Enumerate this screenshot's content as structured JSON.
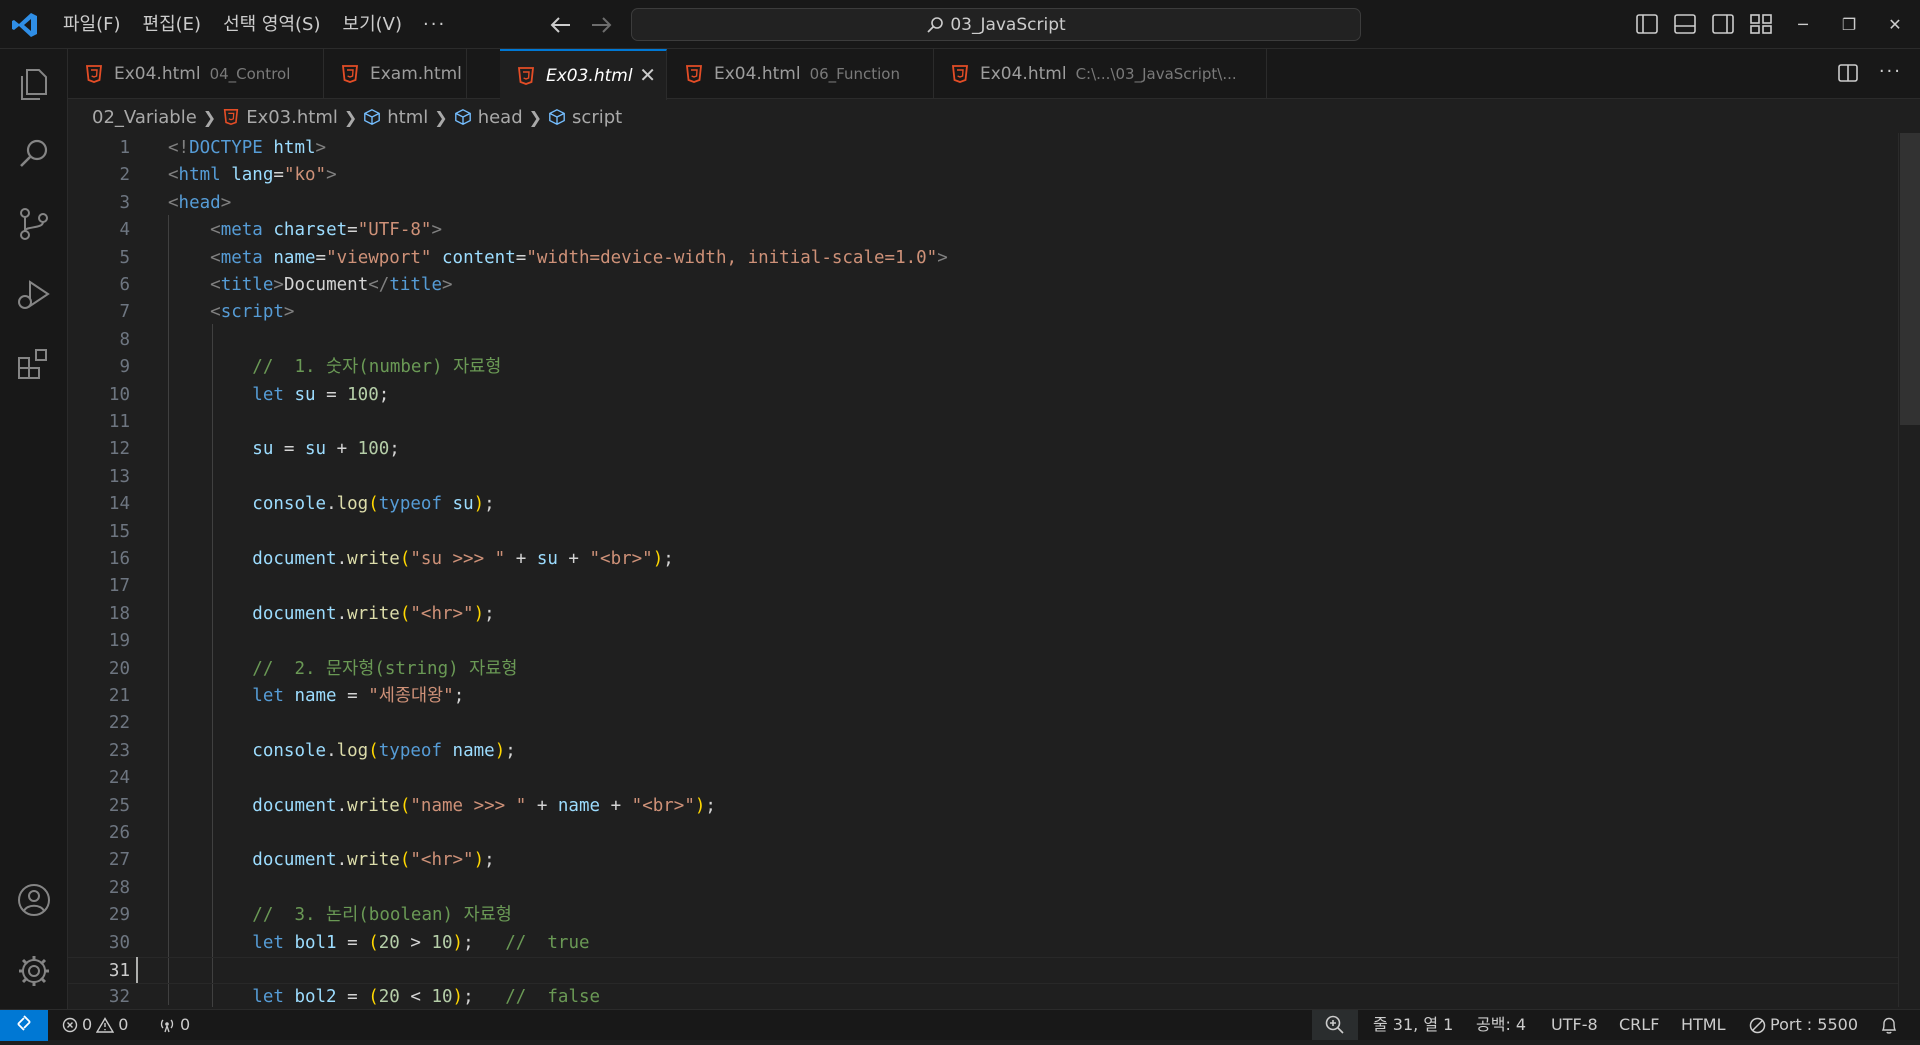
{
  "menu": {
    "items": [
      "파일(F)",
      "편집(E)",
      "선택 영역(S)",
      "보기(V)"
    ],
    "more": "···"
  },
  "command_center": {
    "text": "03_JavaScript"
  },
  "tabs": [
    {
      "name": "Ex04.html",
      "desc": "04_Control",
      "active": false
    },
    {
      "name": "Exam.html",
      "desc": "",
      "active": false
    },
    {
      "name": "Ex03.html",
      "desc": "",
      "active": true
    },
    {
      "name": "Ex04.html",
      "desc": "06_Function",
      "active": false
    },
    {
      "name": "Ex04.html",
      "desc": "C:\\...\\03_JavaScript\\...",
      "active": false
    }
  ],
  "tab_close_glyph": "✕",
  "tab_actions_more": "···",
  "breadcrumb": {
    "folder": "02_Variable",
    "file": "Ex03.html",
    "items": [
      "html",
      "head",
      "script"
    ]
  },
  "current_line": 31,
  "code_lines": [
    [
      [
        "t-br",
        "<!"
      ],
      [
        "t-tag",
        "DOCTYPE "
      ],
      [
        "t-attr",
        "html"
      ],
      [
        "t-br",
        ">"
      ]
    ],
    [
      [
        "t-br",
        "<"
      ],
      [
        "t-tag",
        "html "
      ],
      [
        "t-attr",
        "lang"
      ],
      [
        "t-txt",
        "="
      ],
      [
        "t-str",
        "\"ko\""
      ],
      [
        "t-br",
        ">"
      ]
    ],
    [
      [
        "t-br",
        "<"
      ],
      [
        "t-tag",
        "head"
      ],
      [
        "t-br",
        ">"
      ]
    ],
    [
      [
        "t-txt",
        "    "
      ],
      [
        "t-br",
        "<"
      ],
      [
        "t-tag",
        "meta "
      ],
      [
        "t-attr",
        "charset"
      ],
      [
        "t-txt",
        "="
      ],
      [
        "t-str",
        "\"UTF-8\""
      ],
      [
        "t-br",
        ">"
      ]
    ],
    [
      [
        "t-txt",
        "    "
      ],
      [
        "t-br",
        "<"
      ],
      [
        "t-tag",
        "meta "
      ],
      [
        "t-attr",
        "name"
      ],
      [
        "t-txt",
        "="
      ],
      [
        "t-str",
        "\"viewport\" "
      ],
      [
        "t-attr",
        "content"
      ],
      [
        "t-txt",
        "="
      ],
      [
        "t-str",
        "\"width=device-width, initial-scale=1.0\""
      ],
      [
        "t-br",
        ">"
      ]
    ],
    [
      [
        "t-txt",
        "    "
      ],
      [
        "t-br",
        "<"
      ],
      [
        "t-tag",
        "title"
      ],
      [
        "t-br",
        ">"
      ],
      [
        "t-txt",
        "Document"
      ],
      [
        "t-br",
        "</"
      ],
      [
        "t-tag",
        "title"
      ],
      [
        "t-br",
        ">"
      ]
    ],
    [
      [
        "t-txt",
        "    "
      ],
      [
        "t-br",
        "<"
      ],
      [
        "t-tag",
        "script"
      ],
      [
        "t-br",
        ">"
      ]
    ],
    [],
    [
      [
        "t-txt",
        "        "
      ],
      [
        "t-com",
        "//  1. 숫자(number) 자료형"
      ]
    ],
    [
      [
        "t-txt",
        "        "
      ],
      [
        "t-kw",
        "let "
      ],
      [
        "t-var",
        "su"
      ],
      [
        "t-txt",
        " = "
      ],
      [
        "t-num",
        "100"
      ],
      [
        "t-txt",
        ";"
      ]
    ],
    [],
    [
      [
        "t-txt",
        "        "
      ],
      [
        "t-var",
        "su"
      ],
      [
        "t-txt",
        " = "
      ],
      [
        "t-var",
        "su"
      ],
      [
        "t-txt",
        " + "
      ],
      [
        "t-num",
        "100"
      ],
      [
        "t-txt",
        ";"
      ]
    ],
    [],
    [
      [
        "t-txt",
        "        "
      ],
      [
        "t-var",
        "console"
      ],
      [
        "t-txt",
        "."
      ],
      [
        "t-fn",
        "log"
      ],
      [
        "t-paren",
        "("
      ],
      [
        "t-kw",
        "typeof "
      ],
      [
        "t-var",
        "su"
      ],
      [
        "t-paren",
        ")"
      ],
      [
        "t-txt",
        ";"
      ]
    ],
    [],
    [
      [
        "t-txt",
        "        "
      ],
      [
        "t-var",
        "document"
      ],
      [
        "t-txt",
        "."
      ],
      [
        "t-fn",
        "write"
      ],
      [
        "t-paren",
        "("
      ],
      [
        "t-str",
        "\"su >>> \""
      ],
      [
        "t-txt",
        " + "
      ],
      [
        "t-var",
        "su"
      ],
      [
        "t-txt",
        " + "
      ],
      [
        "t-str",
        "\"<br>\""
      ],
      [
        "t-paren",
        ")"
      ],
      [
        "t-txt",
        ";"
      ]
    ],
    [],
    [
      [
        "t-txt",
        "        "
      ],
      [
        "t-var",
        "document"
      ],
      [
        "t-txt",
        "."
      ],
      [
        "t-fn",
        "write"
      ],
      [
        "t-paren",
        "("
      ],
      [
        "t-str",
        "\"<hr>\""
      ],
      [
        "t-paren",
        ")"
      ],
      [
        "t-txt",
        ";"
      ]
    ],
    [],
    [
      [
        "t-txt",
        "        "
      ],
      [
        "t-com",
        "//  2. 문자형(string) 자료형"
      ]
    ],
    [
      [
        "t-txt",
        "        "
      ],
      [
        "t-kw",
        "let "
      ],
      [
        "t-var",
        "name"
      ],
      [
        "t-txt",
        " = "
      ],
      [
        "t-str",
        "\"세종대왕\""
      ],
      [
        "t-txt",
        ";"
      ]
    ],
    [],
    [
      [
        "t-txt",
        "        "
      ],
      [
        "t-var",
        "console"
      ],
      [
        "t-txt",
        "."
      ],
      [
        "t-fn",
        "log"
      ],
      [
        "t-paren",
        "("
      ],
      [
        "t-kw",
        "typeof "
      ],
      [
        "t-var",
        "name"
      ],
      [
        "t-paren",
        ")"
      ],
      [
        "t-txt",
        ";"
      ]
    ],
    [],
    [
      [
        "t-txt",
        "        "
      ],
      [
        "t-var",
        "document"
      ],
      [
        "t-txt",
        "."
      ],
      [
        "t-fn",
        "write"
      ],
      [
        "t-paren",
        "("
      ],
      [
        "t-str",
        "\"name >>> \""
      ],
      [
        "t-txt",
        " + "
      ],
      [
        "t-var",
        "name"
      ],
      [
        "t-txt",
        " + "
      ],
      [
        "t-str",
        "\"<br>\""
      ],
      [
        "t-paren",
        ")"
      ],
      [
        "t-txt",
        ";"
      ]
    ],
    [],
    [
      [
        "t-txt",
        "        "
      ],
      [
        "t-var",
        "document"
      ],
      [
        "t-txt",
        "."
      ],
      [
        "t-fn",
        "write"
      ],
      [
        "t-paren",
        "("
      ],
      [
        "t-str",
        "\"<hr>\""
      ],
      [
        "t-paren",
        ")"
      ],
      [
        "t-txt",
        ";"
      ]
    ],
    [],
    [
      [
        "t-txt",
        "        "
      ],
      [
        "t-com",
        "//  3. 논리(boolean) 자료형"
      ]
    ],
    [
      [
        "t-txt",
        "        "
      ],
      [
        "t-kw",
        "let "
      ],
      [
        "t-var",
        "bol1"
      ],
      [
        "t-txt",
        " = "
      ],
      [
        "t-paren",
        "("
      ],
      [
        "t-num",
        "20"
      ],
      [
        "t-txt",
        " > "
      ],
      [
        "t-num",
        "10"
      ],
      [
        "t-paren",
        ")"
      ],
      [
        "t-txt",
        ";   "
      ],
      [
        "t-com",
        "//  true"
      ]
    ],
    [],
    [
      [
        "t-txt",
        "        "
      ],
      [
        "t-kw",
        "let "
      ],
      [
        "t-var",
        "bol2"
      ],
      [
        "t-txt",
        " = "
      ],
      [
        "t-paren",
        "("
      ],
      [
        "t-num",
        "20"
      ],
      [
        "t-txt",
        " < "
      ],
      [
        "t-num",
        "10"
      ],
      [
        "t-paren",
        ")"
      ],
      [
        "t-txt",
        ";   "
      ],
      [
        "t-com",
        "//  false"
      ]
    ]
  ],
  "colors": {
    "accent": "#0078d4",
    "html_icon": "#e44d26",
    "background": "#1f1f1f"
  },
  "status": {
    "errors": "0",
    "warnings": "0",
    "ports": "0",
    "position": "줄 31, 열 1",
    "spaces": "공백: 4",
    "encoding": "UTF-8",
    "eol": "CRLF",
    "language": "HTML",
    "port": "Port : 5500"
  }
}
